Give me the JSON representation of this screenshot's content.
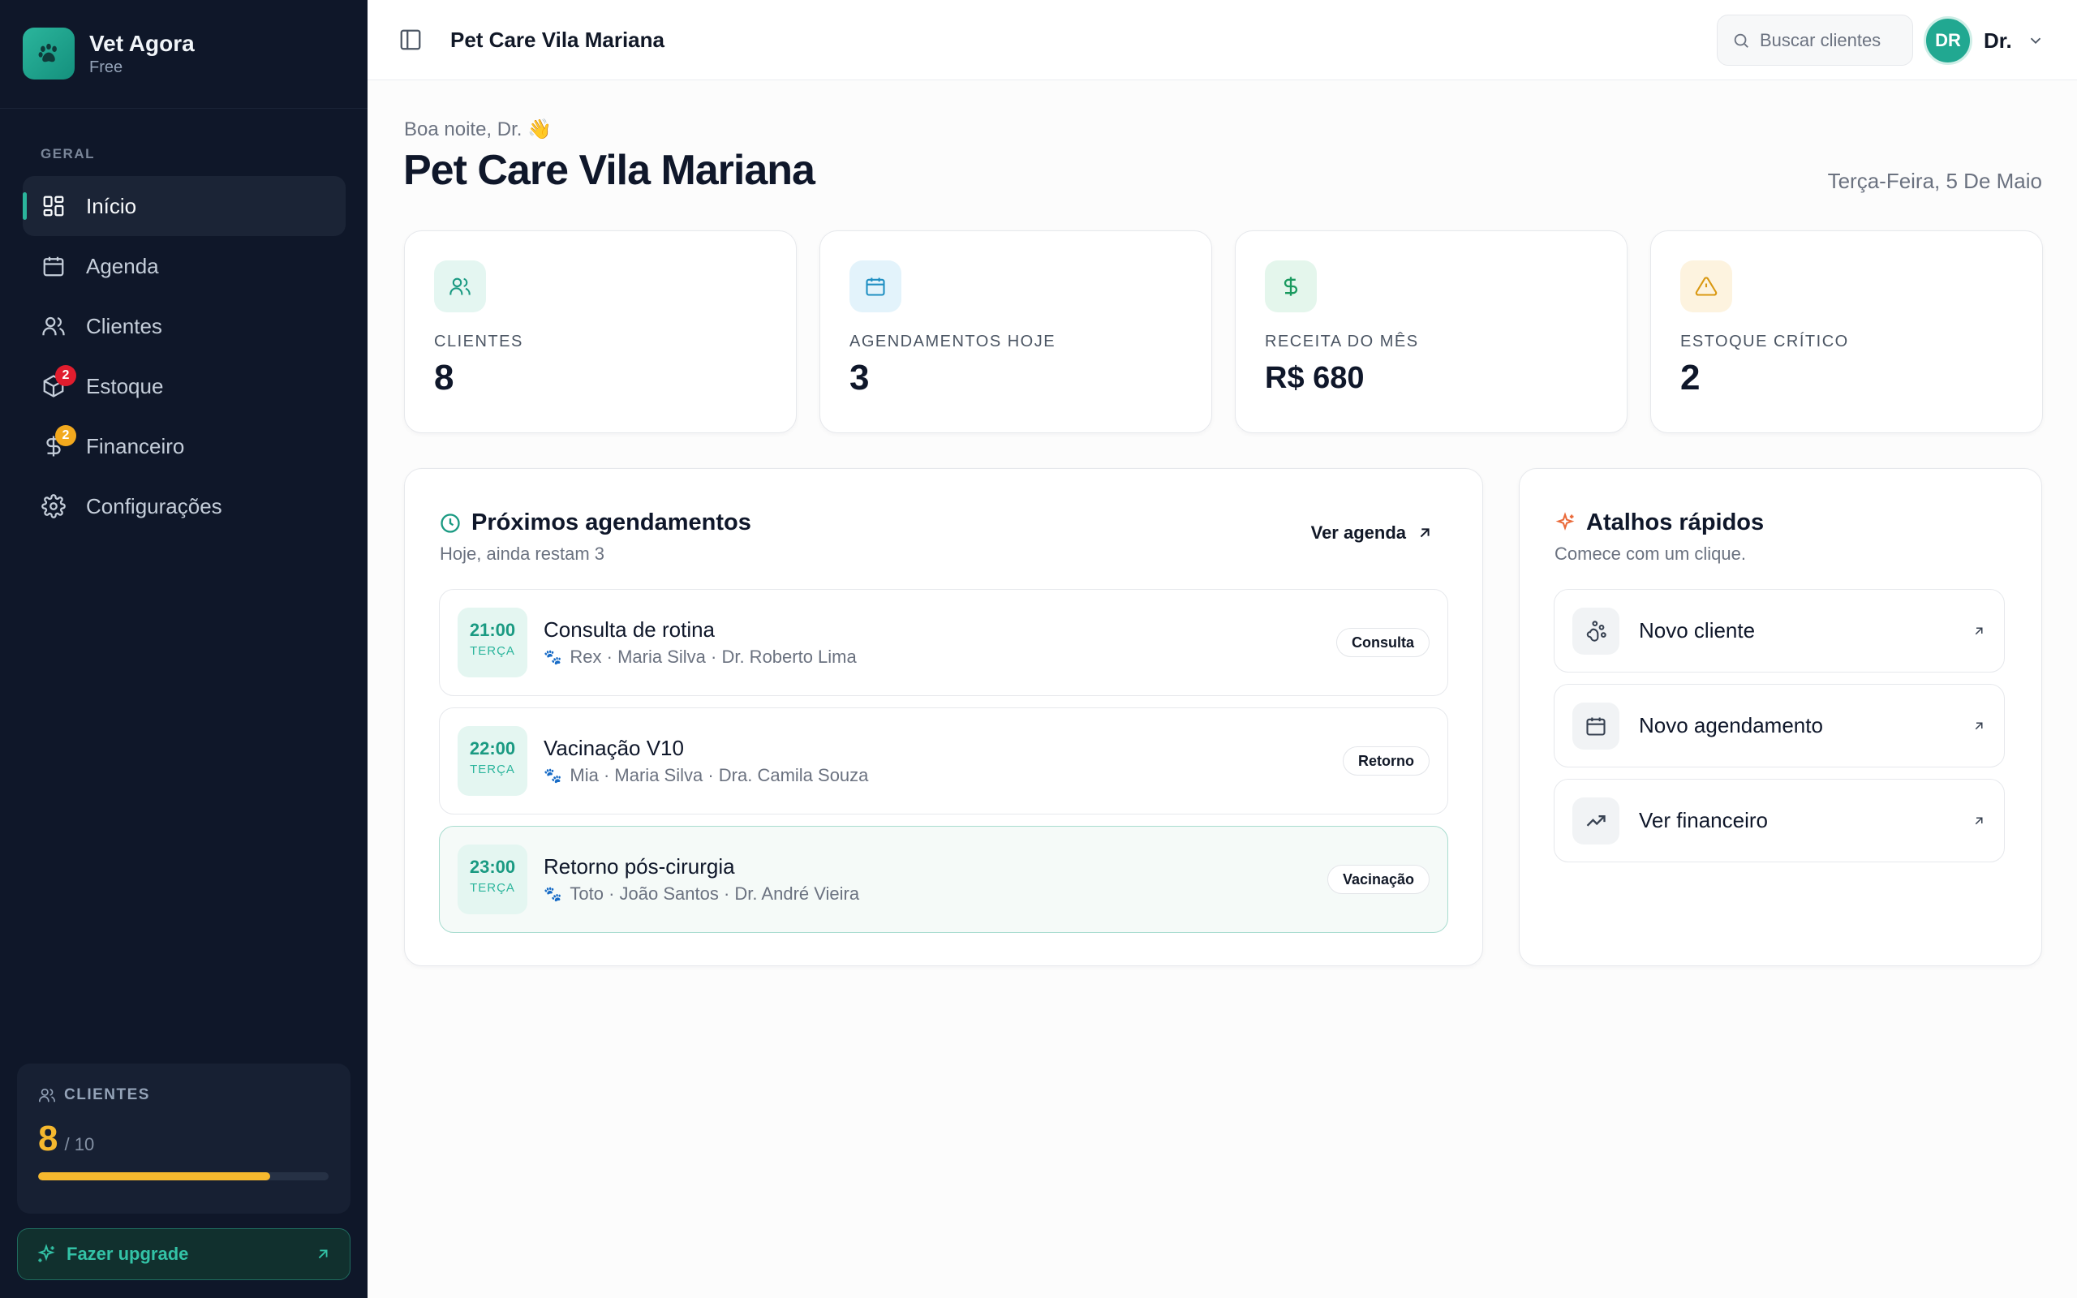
{
  "brand": {
    "name": "Vet Agora",
    "plan": "Free"
  },
  "nav": {
    "section": "GERAL",
    "items": [
      {
        "label": "Início",
        "icon": "dashboard-icon",
        "active": true
      },
      {
        "label": "Agenda",
        "icon": "calendar-icon"
      },
      {
        "label": "Clientes",
        "icon": "users-icon"
      },
      {
        "label": "Estoque",
        "icon": "package-icon",
        "badge": "2",
        "badge_color": "#e11d2e"
      },
      {
        "label": "Financeiro",
        "icon": "dollar-icon",
        "badge": "2",
        "badge_color": "#f2a91e"
      },
      {
        "label": "Configurações",
        "icon": "gear-icon"
      }
    ]
  },
  "quota": {
    "label": "CLIENTES",
    "count": "8",
    "max": "/ 10",
    "fraction": 0.8
  },
  "upgrade": {
    "label": "Fazer upgrade"
  },
  "topbar": {
    "title": "Pet Care Vila Mariana",
    "search_placeholder": "Buscar clientes",
    "user_initials": "DR",
    "user_name": "Dr."
  },
  "header": {
    "greeting": "Boa noite, Dr. 👋",
    "title": "Pet Care Vila Mariana",
    "date": "Terça-Feira, 5 De Maio"
  },
  "stats": [
    {
      "label": "CLIENTES",
      "value": "8",
      "icon": "users-icon",
      "icon_bg": "#e4f6f1",
      "icon_color": "#1a9a82"
    },
    {
      "label": "AGENDAMENTOS HOJE",
      "value": "3",
      "icon": "calendar-icon",
      "icon_bg": "#e3f3fb",
      "icon_color": "#1f8fc2"
    },
    {
      "label": "RECEITA DO MÊS",
      "value": "R$ 680",
      "icon": "dollar-icon",
      "icon_bg": "#e4f6ec",
      "icon_color": "#1a9a5f"
    },
    {
      "label": "ESTOQUE CRÍTICO",
      "value": "2",
      "icon": "warning-icon",
      "icon_bg": "#fdf3df",
      "icon_color": "#d99812"
    }
  ],
  "appointments": {
    "title": "Próximos agendamentos",
    "subtitle": "Hoje, ainda restam 3",
    "link": "Ver agenda",
    "items": [
      {
        "time": "21:00",
        "day": "TERÇA",
        "title": "Consulta de rotina",
        "meta": "Rex · Maria Silva · Dr. Roberto Lima",
        "badge": "Consulta"
      },
      {
        "time": "22:00",
        "day": "TERÇA",
        "title": "Vacinação V10",
        "meta": "Mia · Maria Silva · Dra. Camila Souza",
        "badge": "Retorno"
      },
      {
        "time": "23:00",
        "day": "TERÇA",
        "title": "Retorno pós-cirurgia",
        "meta": "Toto · João Santos · Dr. André Vieira",
        "badge": "Vacinação"
      }
    ]
  },
  "shortcuts": {
    "title": "Atalhos rápidos",
    "subtitle": "Comece com um clique.",
    "items": [
      {
        "label": "Novo cliente",
        "icon": "paw-icon"
      },
      {
        "label": "Novo agendamento",
        "icon": "calendar-icon"
      },
      {
        "label": "Ver financeiro",
        "icon": "trend-up-icon"
      }
    ]
  },
  "colors": {
    "accent": "#2bb59c",
    "sidebar_bg": "#0f1729",
    "warning": "#f5b82e",
    "danger": "#e11d2e"
  }
}
